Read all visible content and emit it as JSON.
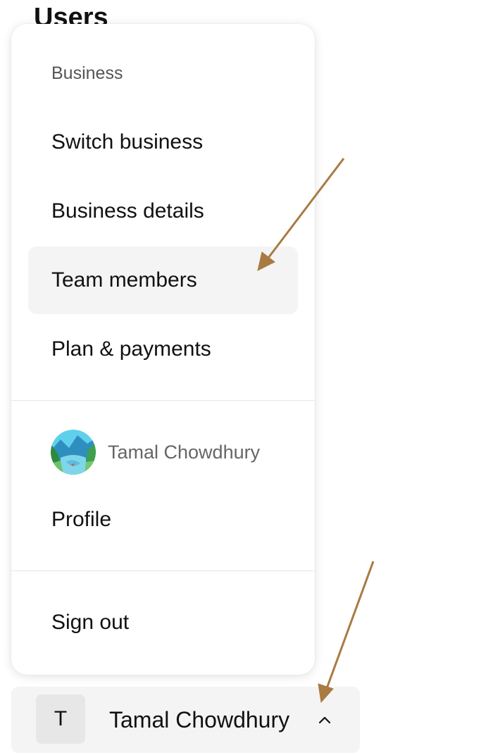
{
  "page": {
    "title": "Users"
  },
  "menu": {
    "section_label": "Business",
    "items": [
      {
        "label": "Switch business",
        "active": false
      },
      {
        "label": "Business details",
        "active": false
      },
      {
        "label": "Team members",
        "active": true
      },
      {
        "label": "Plan & payments",
        "active": false
      }
    ],
    "profile": {
      "name": "Tamal Chowdhury",
      "avatar": "landscape-avatar-icon",
      "link_label": "Profile"
    },
    "sign_out_label": "Sign out"
  },
  "user_button": {
    "initial": "T",
    "name": "Tamal Chowdhury",
    "icon": "chevron-up-icon"
  },
  "colors": {
    "annotation_arrow": "#a97a41",
    "active_item_bg": "#f4f4f4",
    "muted_text": "#666666"
  }
}
